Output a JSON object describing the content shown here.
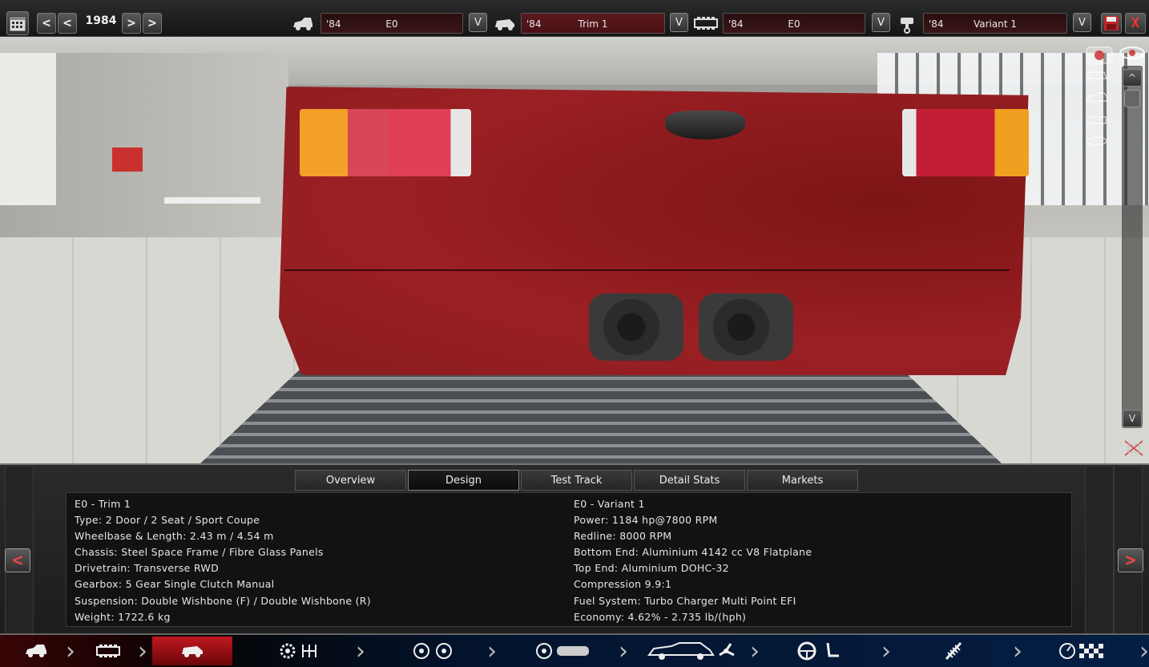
{
  "topbar": {
    "year": "1984",
    "prev_label": "<",
    "next_label": ">",
    "selectors": [
      {
        "year": "'84",
        "name": "E0",
        "v_label": "V"
      },
      {
        "year": "'84",
        "name": "Trim 1",
        "v_label": "V"
      },
      {
        "year": "'84",
        "name": "E0",
        "v_label": "V"
      },
      {
        "year": "'84",
        "name": "Variant 1",
        "v_label": "V"
      }
    ],
    "close_label": "X"
  },
  "viewport": {
    "scroll_up_label": "^",
    "scroll_down_label": "V"
  },
  "panel": {
    "tabs": [
      "Overview",
      "Design",
      "Test Track",
      "Detail Stats",
      "Markets"
    ],
    "active_tab": "Design",
    "prev_label": "<",
    "next_label": ">",
    "left_info": [
      "E0 - Trim 1",
      "Type: 2 Door / 2 Seat / Sport Coupe",
      "Wheelbase & Length: 2.43 m / 4.54 m",
      "Chassis: Steel Space Frame / Fibre Glass Panels",
      "Drivetrain: Transverse RWD",
      "Gearbox: 5 Gear Single Clutch Manual",
      "Suspension: Double Wishbone (F) / Double Wishbone (R)",
      "Weight: 1722.6 kg"
    ],
    "right_info": [
      "E0 - Variant 1",
      "Power: 1184 hp@7800 RPM",
      "Redline: 8000 RPM",
      "Bottom End: Aluminium 4142 cc V8 Flatplane",
      "Top End: Aluminium DOHC-32",
      "Compression 9.9:1",
      "Fuel System: Turbo Charger Multi Point EFI",
      "Economy: 4.62% - 2.735 lb/(hph)"
    ]
  },
  "bottom_nav": {
    "items": [
      "car-model-icon",
      "engine-icon",
      "trim-icon",
      "gearbox-icon",
      "wheels-icon",
      "body-icon",
      "interior-icon",
      "suspension-icon",
      "test-track-icon"
    ]
  },
  "colors": {
    "accent_red": "#c01820",
    "car_body": "#8b1a1c",
    "bottom_nav_blue": "#041e44"
  }
}
